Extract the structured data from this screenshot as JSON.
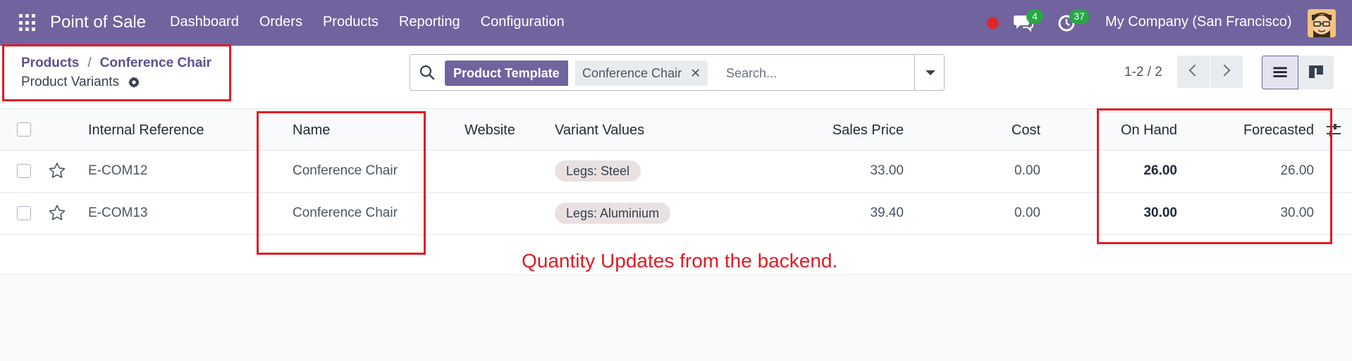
{
  "navbar": {
    "app_title": "Point of Sale",
    "menu": [
      "Dashboard",
      "Orders",
      "Products",
      "Reporting",
      "Configuration"
    ],
    "chat_count": "4",
    "activity_count": "37",
    "company": "My Company (San Francisco)",
    "bg_color": "#71639e"
  },
  "breadcrumb": {
    "items": [
      "Products",
      "Conference Chair"
    ],
    "separator": "/",
    "current": "Product Variants"
  },
  "search": {
    "facet_label": "Product Template",
    "facet_value": "Conference Chair",
    "facet_close": "✕",
    "placeholder": "Search..."
  },
  "pager": {
    "text": "1-2 / 2"
  },
  "table": {
    "headers": {
      "internal_reference": "Internal Reference",
      "name": "Name",
      "website": "Website",
      "variant_values": "Variant Values",
      "sales_price": "Sales Price",
      "cost": "Cost",
      "on_hand": "On Hand",
      "forecasted": "Forecasted"
    },
    "rows": [
      {
        "internal_reference": "E-COM12",
        "name": "Conference Chair",
        "website": "",
        "variant": "Legs: Steel",
        "sales_price": "33.00",
        "cost": "0.00",
        "on_hand": "26.00",
        "forecasted": "26.00"
      },
      {
        "internal_reference": "E-COM13",
        "name": "Conference Chair",
        "website": "",
        "variant": "Legs: Aluminium",
        "sales_price": "39.40",
        "cost": "0.00",
        "on_hand": "30.00",
        "forecasted": "30.00"
      }
    ]
  },
  "annotation": {
    "text": "Quantity Updates from the backend.",
    "color": "#e01b24"
  }
}
